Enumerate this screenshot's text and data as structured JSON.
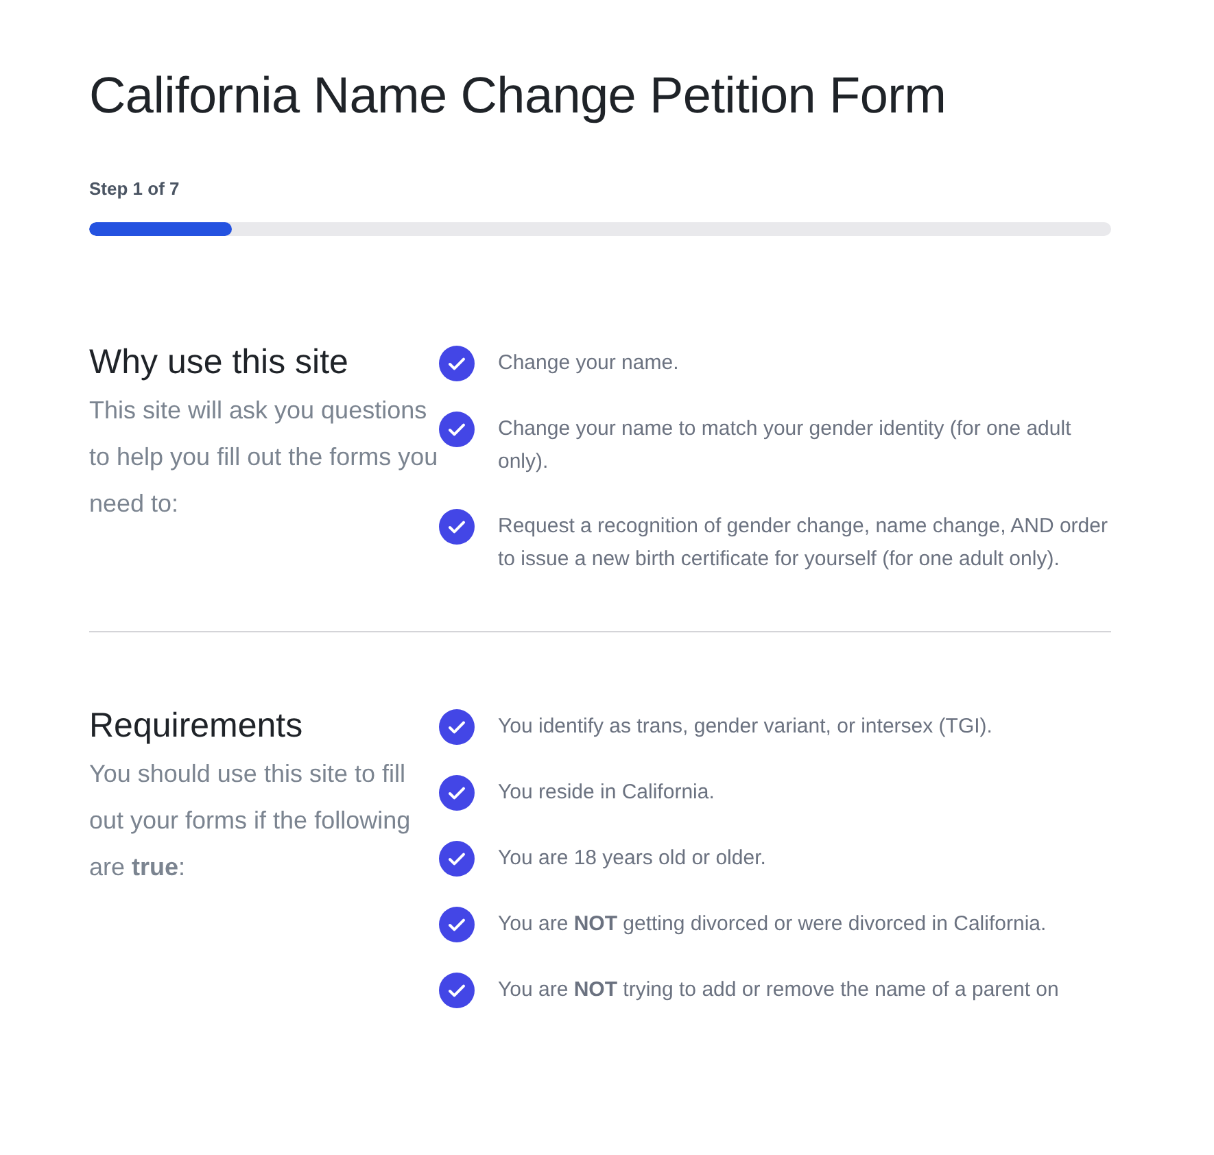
{
  "title": "California Name Change Petition Form",
  "progress": {
    "label": "Step 1 of 7",
    "level": 0.14
  },
  "sections": [
    {
      "heading": "Why use this site",
      "description": "This site will ask you questions to help you fill out the forms you need to:",
      "items": [
        "Change your name.",
        "Change your name to match your gender identity (for one adult only).",
        "Request a recognition of gender change, name change, AND order to issue a new birth certificate for yourself (for one adult only)."
      ]
    },
    {
      "heading": "Requirements",
      "description": "You should use this site to fill out your forms if the following are **true**:",
      "items": [
        "You identify as trans, gender variant, or intersex (TGI).",
        "You reside in California.",
        "You are 18 years old or older.",
        "You are **NOT** getting divorced or were divorced in California.",
        "You are **NOT** trying to add or remove the name of a parent on"
      ]
    }
  ]
}
